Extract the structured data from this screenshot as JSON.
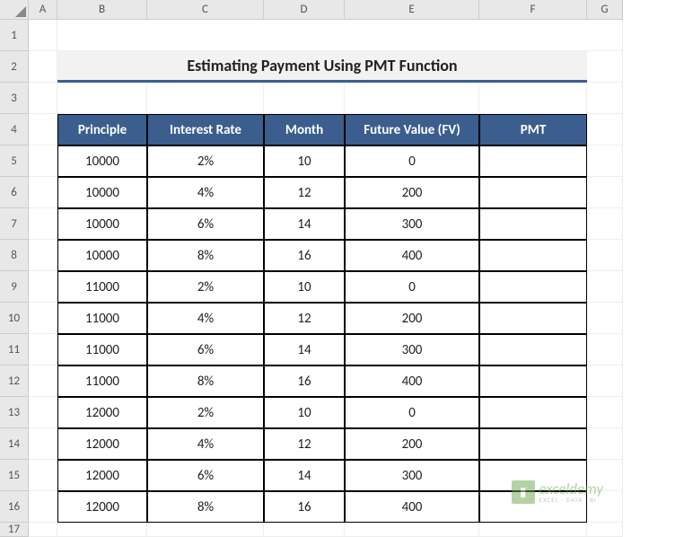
{
  "columns": [
    "A",
    "B",
    "C",
    "D",
    "E",
    "F",
    "G"
  ],
  "rows": [
    "1",
    "2",
    "3",
    "4",
    "5",
    "6",
    "7",
    "8",
    "9",
    "10",
    "11",
    "12",
    "13",
    "14",
    "15",
    "16",
    "17"
  ],
  "title": "Estimating Payment Using PMT Function",
  "headers": {
    "principle": "Principle",
    "interest_rate": "Interest Rate",
    "month": "Month",
    "fv": "Future Value (FV)",
    "pmt": "PMT"
  },
  "data": [
    {
      "principle": "10000",
      "rate": "2%",
      "month": "10",
      "fv": "0",
      "pmt": ""
    },
    {
      "principle": "10000",
      "rate": "4%",
      "month": "12",
      "fv": "200",
      "pmt": ""
    },
    {
      "principle": "10000",
      "rate": "6%",
      "month": "14",
      "fv": "300",
      "pmt": ""
    },
    {
      "principle": "10000",
      "rate": "8%",
      "month": "16",
      "fv": "400",
      "pmt": ""
    },
    {
      "principle": "11000",
      "rate": "2%",
      "month": "10",
      "fv": "0",
      "pmt": ""
    },
    {
      "principle": "11000",
      "rate": "4%",
      "month": "12",
      "fv": "200",
      "pmt": ""
    },
    {
      "principle": "11000",
      "rate": "6%",
      "month": "14",
      "fv": "300",
      "pmt": ""
    },
    {
      "principle": "11000",
      "rate": "8%",
      "month": "16",
      "fv": "400",
      "pmt": ""
    },
    {
      "principle": "12000",
      "rate": "2%",
      "month": "10",
      "fv": "0",
      "pmt": ""
    },
    {
      "principle": "12000",
      "rate": "4%",
      "month": "12",
      "fv": "200",
      "pmt": ""
    },
    {
      "principle": "12000",
      "rate": "6%",
      "month": "14",
      "fv": "300",
      "pmt": ""
    },
    {
      "principle": "12000",
      "rate": "8%",
      "month": "16",
      "fv": "400",
      "pmt": ""
    }
  ],
  "watermark": {
    "main": "exceldemy",
    "sub": "EXCEL · DATA · BI"
  }
}
